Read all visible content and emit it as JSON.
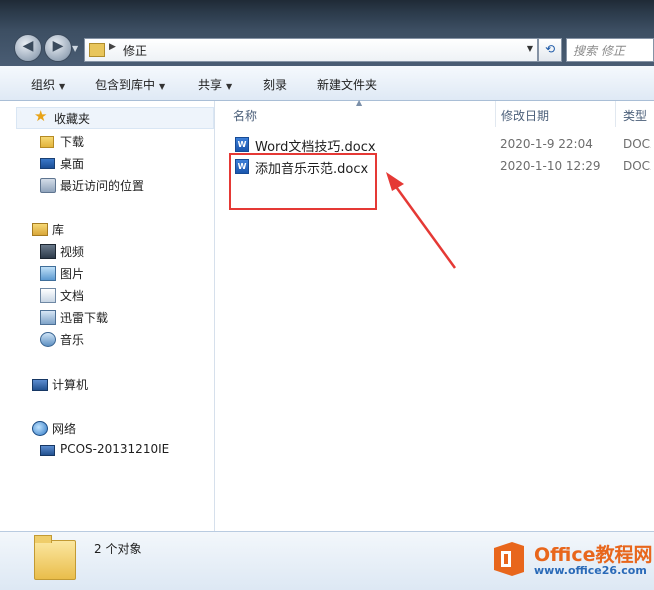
{
  "address": {
    "path": "修正",
    "search_placeholder": "搜索 修正"
  },
  "toolbar": {
    "organize": "组织",
    "include_in_library": "包含到库中",
    "share": "共享",
    "burn": "刻录",
    "new_folder": "新建文件夹"
  },
  "sidebar": {
    "favorites": "收藏夹",
    "downloads": "下载",
    "desktop": "桌面",
    "recent": "最近访问的位置",
    "libraries": "库",
    "videos": "视频",
    "pictures": "图片",
    "documents": "文档",
    "xunlei": "迅雷下载",
    "music": "音乐",
    "computer": "计算机",
    "network": "网络",
    "network_pc": "PCOS-20131210IE"
  },
  "columns": {
    "name": "名称",
    "modified": "修改日期",
    "type": "类型"
  },
  "files": [
    {
      "name": "Word文档技巧.docx",
      "modified": "2020-1-9 22:04",
      "type": "DOCX"
    },
    {
      "name": "添加音乐示范.docx",
      "modified": "2020-1-10 12:29",
      "type": "DOCX"
    }
  ],
  "status": {
    "count": "2 个对象"
  },
  "watermark": {
    "title": "Office教程网",
    "url": "www.office26.com"
  },
  "colors": {
    "highlight": "#e53935",
    "watermark_orange": "#e8661c",
    "watermark_blue": "#2a6ab8"
  }
}
